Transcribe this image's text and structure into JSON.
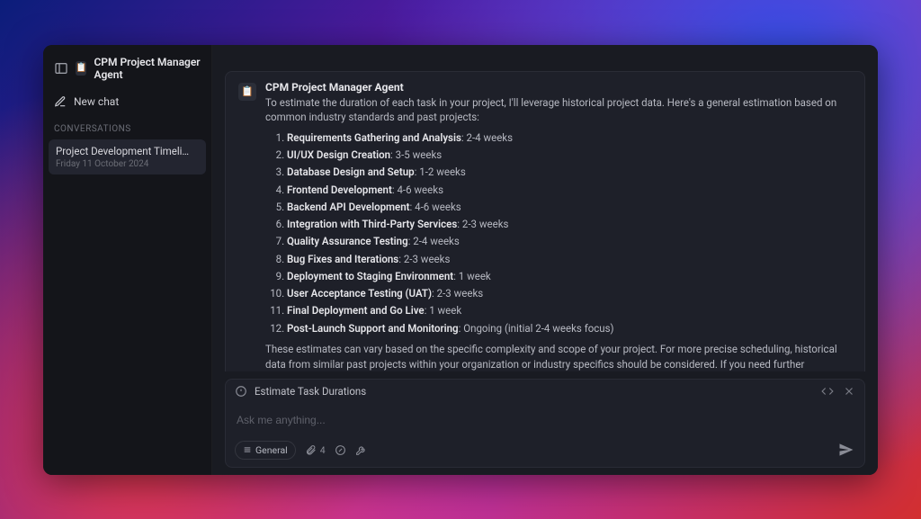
{
  "header": {
    "agent_name": "CPM Project Manager Agent"
  },
  "sidebar": {
    "new_chat_label": "New chat",
    "section_label": "CONVERSATIONS",
    "items": [
      {
        "title": "Project Development Timeli…",
        "date": "Friday 11 October 2024"
      }
    ]
  },
  "message": {
    "author": "CPM Project Manager Agent",
    "intro": "To estimate the duration of each task in your project, I'll leverage historical project data. Here's a general estimation based on common industry standards and past projects:",
    "tasks": [
      {
        "name": "Requirements Gathering and Analysis",
        "dur": "2-4 weeks"
      },
      {
        "name": "UI/UX Design Creation",
        "dur": "3-5 weeks"
      },
      {
        "name": "Database Design and Setup",
        "dur": "1-2 weeks"
      },
      {
        "name": "Frontend Development",
        "dur": "4-6 weeks"
      },
      {
        "name": "Backend API Development",
        "dur": "4-6 weeks"
      },
      {
        "name": "Integration with Third-Party Services",
        "dur": "2-3 weeks"
      },
      {
        "name": "Quality Assurance Testing",
        "dur": "2-4 weeks"
      },
      {
        "name": "Bug Fixes and Iterations",
        "dur": "2-3 weeks"
      },
      {
        "name": "Deployment to Staging Environment",
        "dur": "1 week"
      },
      {
        "name": "User Acceptance Testing (UAT)",
        "dur": "2-3 weeks"
      },
      {
        "name": "Final Deployment and Go Live",
        "dur": "1 week"
      },
      {
        "name": "Post-Launch Support and Monitoring",
        "dur": "Ongoing (initial 2-4 weeks focus)"
      }
    ],
    "outro": "These estimates can vary based on the specific complexity and scope of your project. For more precise scheduling, historical data from similar past projects within your organization or industry specifics should be considered. If you need further refinement or adjustments, let me know!"
  },
  "composer": {
    "context_label": "Estimate Task Durations",
    "placeholder": "Ask me anything...",
    "mode_pill": "General",
    "attachment_count": "4"
  }
}
